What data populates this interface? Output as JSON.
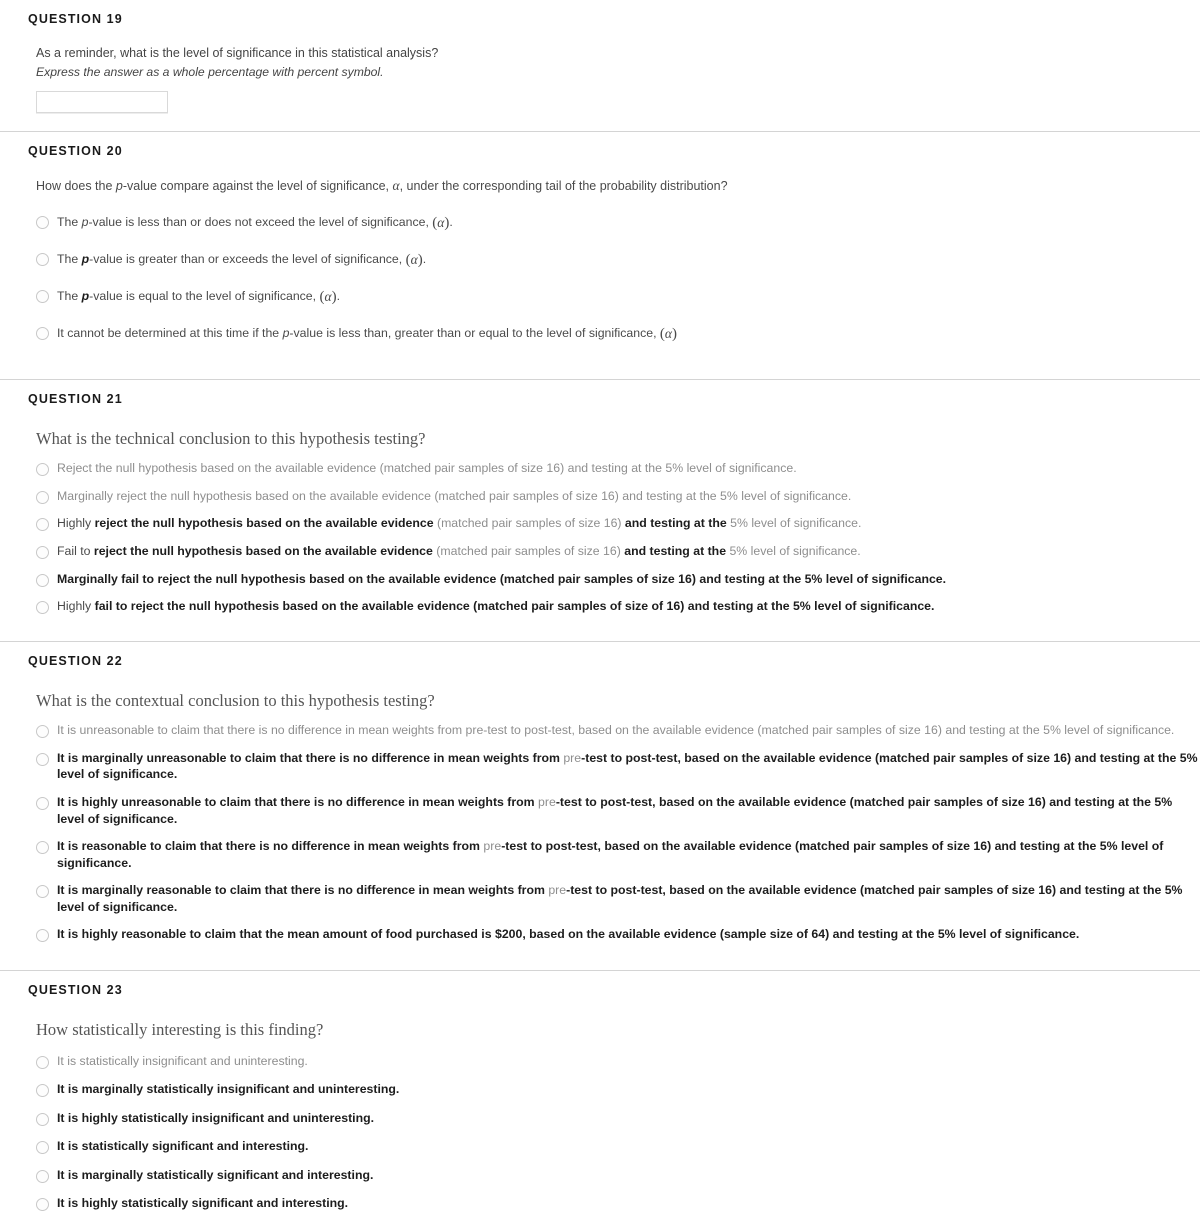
{
  "questions": [
    {
      "heading": "QUESTION 19",
      "prompt": "As a reminder, what is the level of significance in this statistical analysis?",
      "subprompt": "Express the answer as a whole percentage with percent symbol.",
      "input": {
        "value": "",
        "placeholder": ""
      }
    },
    {
      "heading": "QUESTION 20",
      "prompt_parts": [
        {
          "text": "How does the ",
          "style": "normal"
        },
        {
          "text": "p",
          "style": "italic"
        },
        {
          "text": "-value compare against the level of significance, ",
          "style": "normal"
        },
        {
          "text": "α",
          "style": "alpha"
        },
        {
          "text": ", under the corresponding tail of the probability distribution?",
          "style": "normal"
        }
      ],
      "prompt_plain": "How does the p-value compare against the level of significance, α, under the corresponding tail of the probability distribution?",
      "options": [
        {
          "plain": "The p-value is less than or does not exceed the level of significance, (α).",
          "parts": [
            {
              "text": "The ",
              "style": "normal"
            },
            {
              "text": "p",
              "style": "italic"
            },
            {
              "text": "-value is less than or does not exceed the level of significance, ",
              "style": "normal"
            },
            {
              "text": "(α)",
              "style": "paren-alpha"
            },
            {
              "text": ".",
              "style": "normal"
            }
          ]
        },
        {
          "plain": "The p-value is greater than or exceeds the level of significance, (α).",
          "parts": [
            {
              "text": "The ",
              "style": "normal"
            },
            {
              "text": "p",
              "style": "bold-italic"
            },
            {
              "text": "-value is greater than or exceeds the level of significance, ",
              "style": "normal"
            },
            {
              "text": "(α)",
              "style": "paren-alpha"
            },
            {
              "text": ".",
              "style": "normal"
            }
          ]
        },
        {
          "plain": "The p-value is equal to the level of significance, (α).",
          "parts": [
            {
              "text": "The ",
              "style": "normal"
            },
            {
              "text": "p",
              "style": "bold-italic"
            },
            {
              "text": "-value is equal to the level of significance, ",
              "style": "normal"
            },
            {
              "text": "(α)",
              "style": "paren-alpha"
            },
            {
              "text": ".",
              "style": "normal"
            }
          ]
        },
        {
          "plain": "It cannot be determined at this time if the p-value is less than, greater than or equal to the level of significance, (α)",
          "parts": [
            {
              "text": "It cannot be determined at this time if the ",
              "style": "normal"
            },
            {
              "text": "p",
              "style": "italic"
            },
            {
              "text": "-value is less than, greater than or equal to the level of significance, ",
              "style": "normal"
            },
            {
              "text": "(α)",
              "style": "paren-alpha"
            }
          ]
        }
      ]
    },
    {
      "heading": "QUESTION 21",
      "prompt": "What is the technical conclusion to this hypothesis testing?",
      "options": [
        {
          "plain": "Reject the null hypothesis based on the available evidence (matched pair samples of size 16) and testing at the 5% level of significance.",
          "parts": [
            {
              "text": "Reject the null hypothesis based on the available evidence (matched pair samples of size 16) and testing at the 5% level of significance.",
              "style": "gray"
            }
          ]
        },
        {
          "plain": "Marginally reject the null hypothesis based on the available evidence (matched pair samples of size 16) and testing at the 5% level of significance.",
          "parts": [
            {
              "text": "Marginally reject the null hypothesis based on the available evidence (matched pair samples of size 16) and testing at the 5% level of significance.",
              "style": "gray"
            }
          ]
        },
        {
          "plain": "Highly reject the null hypothesis based on the available evidence (matched pair samples of size 16) and testing at the 5% level of significance.",
          "parts": [
            {
              "text": "Highly ",
              "style": "normal"
            },
            {
              "text": "reject the null hypothesis based on the available evidence ",
              "style": "bold"
            },
            {
              "text": "(matched pair samples of size 16) ",
              "style": "gray"
            },
            {
              "text": "and testing at the ",
              "style": "bold"
            },
            {
              "text": "5% level of significance.",
              "style": "gray"
            }
          ]
        },
        {
          "plain": "Fail to reject the null hypothesis based on the available evidence (matched pair samples of size 16) and testing at the 5% level of significance.",
          "parts": [
            {
              "text": "Fail to ",
              "style": "normal"
            },
            {
              "text": "reject the null hypothesis based on the available evidence ",
              "style": "bold"
            },
            {
              "text": "(matched pair samples of size 16) ",
              "style": "gray"
            },
            {
              "text": "and testing at the ",
              "style": "bold"
            },
            {
              "text": "5% level of significance.",
              "style": "gray"
            }
          ]
        },
        {
          "plain": "Marginally fail to reject the null hypothesis based on the available evidence (matched pair samples of size 16) and testing at the 5% level of significance.",
          "parts": [
            {
              "text": "Marginally fail to reject the null hypothesis based on the available evidence (matched pair samples of size 16) and testing at the 5% level of significance.",
              "style": "bold"
            }
          ]
        },
        {
          "plain": "Highly fail to reject the null hypothesis based on the available evidence (matched pair samples of size of 16) and testing at the 5% level of significance.",
          "parts": [
            {
              "text": "Highly ",
              "style": "normal"
            },
            {
              "text": "fail to reject the null hypothesis based on the available evidence (matched pair samples of size of 16) and testing at the 5% level of significance.",
              "style": "bold"
            }
          ]
        }
      ]
    },
    {
      "heading": "QUESTION 22",
      "prompt": "What is the contextual conclusion to this hypothesis testing?",
      "options": [
        {
          "plain": "It is unreasonable to claim that there is no difference in mean weights from pre-test to post-test, based on the available evidence (matched pair samples of size 16) and testing at the 5% level of significance.",
          "parts": [
            {
              "text": "It is unreasonable to claim that there is no difference in mean weights from pre-test to post-test, based on the available evidence (matched pair samples of size 16) and testing at the 5% level of significance.",
              "style": "gray"
            }
          ]
        },
        {
          "plain": "It is marginally unreasonable to claim that there is no difference in mean weights from pre-test to post-test, based on the available evidence (matched pair samples of size 16) and testing at the 5% level of significance.",
          "parts": [
            {
              "text": "It is marginally unreasonable to claim that there is no difference in mean weights from ",
              "style": "bold"
            },
            {
              "text": "pre",
              "style": "gray"
            },
            {
              "text": "-test to post-test, based on the available evidence (matched pair samples of size 16) and testing at the 5% level of significance.",
              "style": "bold"
            }
          ]
        },
        {
          "plain": "It is highly unreasonable to claim that there is no difference in mean weights from pre-test to post-test, based on the available evidence (matched pair samples of size 16) and testing at the 5% level of significance.",
          "parts": [
            {
              "text": "It is highly unreasonable to claim that there is no difference in mean weights from ",
              "style": "bold"
            },
            {
              "text": "pre",
              "style": "gray"
            },
            {
              "text": "-test to post-test, based on the available evidence (matched pair samples of size 16) and testing at the 5% level of significance.",
              "style": "bold"
            }
          ]
        },
        {
          "plain": "It is reasonable to claim that there is no difference in mean weights from pre-test to post-test, based on the available evidence (matched pair samples of size 16) and testing at the 5% level of significance.",
          "parts": [
            {
              "text": "It is reasonable to claim that there is no difference in mean weights from ",
              "style": "bold"
            },
            {
              "text": "pre",
              "style": "gray"
            },
            {
              "text": "-test to post-test, based on the available evidence (matched pair samples of size 16) and testing at the 5% level of significance.",
              "style": "bold"
            }
          ]
        },
        {
          "plain": "It is marginally reasonable to claim that there is no difference in mean weights from pre-test to post-test, based on the available evidence (matched pair samples of size 16) and testing at the 5% level of significance.",
          "parts": [
            {
              "text": "It is marginally reasonable to claim that there is no difference in mean weights from ",
              "style": "bold"
            },
            {
              "text": "pre",
              "style": "gray"
            },
            {
              "text": "-test to post-test, based on the available evidence (matched pair samples of size 16) and testing at the 5% level of significance.",
              "style": "bold"
            }
          ]
        },
        {
          "plain": "It is highly reasonable to claim that the mean amount of food purchased is $200, based on the available evidence (sample size of 64) and testing at the 5% level of significance.",
          "parts": [
            {
              "text": "It is highly reasonable to claim that the mean amount of food purchased is $200, based on the available evidence (sample size of 64) and testing at the 5% level of significance.",
              "style": "bold"
            }
          ]
        }
      ]
    },
    {
      "heading": "QUESTION 23",
      "prompt": "How statistically interesting is this finding?",
      "options": [
        {
          "plain": "It is statistically insignificant and uninteresting.",
          "parts": [
            {
              "text": "It is statistically insignificant and uninteresting.",
              "style": "gray"
            }
          ]
        },
        {
          "plain": "It is marginally statistically insignificant and uninteresting.",
          "parts": [
            {
              "text": "It is marginally statistically insignificant and uninteresting.",
              "style": "bold"
            }
          ]
        },
        {
          "plain": "It is highly statistically insignificant and uninteresting.",
          "parts": [
            {
              "text": "It is highly statistically insignificant and uninteresting.",
              "style": "bold"
            }
          ]
        },
        {
          "plain": "It is statistically significant and interesting.",
          "parts": [
            {
              "text": "It is statistically significant and interesting.",
              "style": "bold"
            }
          ]
        },
        {
          "plain": "It is marginally statistically significant and interesting.",
          "parts": [
            {
              "text": "It is marginally statistically significant and interesting.",
              "style": "bold"
            }
          ]
        },
        {
          "plain": "It is highly statistically significant and interesting.",
          "parts": [
            {
              "text": "It is highly statistically significant and interesting.",
              "style": "bold"
            }
          ]
        }
      ]
    }
  ],
  "colors": {
    "divider": "#d4d4d4",
    "heading": "#1a1a1a",
    "body_text": "#4a4a4a",
    "muted_text": "#8e8e8e",
    "input_border": "#d9d9d9"
  }
}
